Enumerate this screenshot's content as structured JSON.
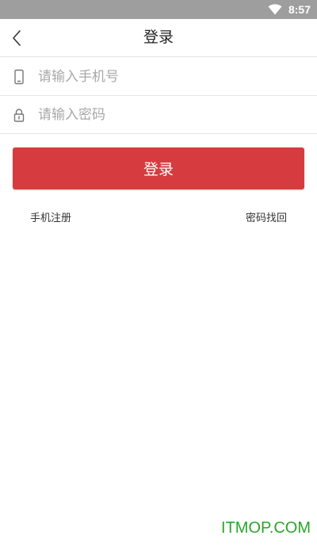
{
  "status_bar": {
    "time": "8:57",
    "wifi_icon": "wifi-icon"
  },
  "header": {
    "title": "登录",
    "back_icon": "chevron-left-icon"
  },
  "form": {
    "phone": {
      "icon": "phone-icon",
      "placeholder": "请输入手机号",
      "value": ""
    },
    "password": {
      "icon": "lock-icon",
      "placeholder": "请输入密码",
      "value": ""
    },
    "login_label": "登录"
  },
  "links": {
    "register": "手机注册",
    "forgot": "密码找回"
  },
  "watermark": "ITMOP.COM",
  "colors": {
    "status_bar": "#9e9e9e",
    "primary_button": "#d63c3f",
    "watermark": "#2aa52a"
  }
}
